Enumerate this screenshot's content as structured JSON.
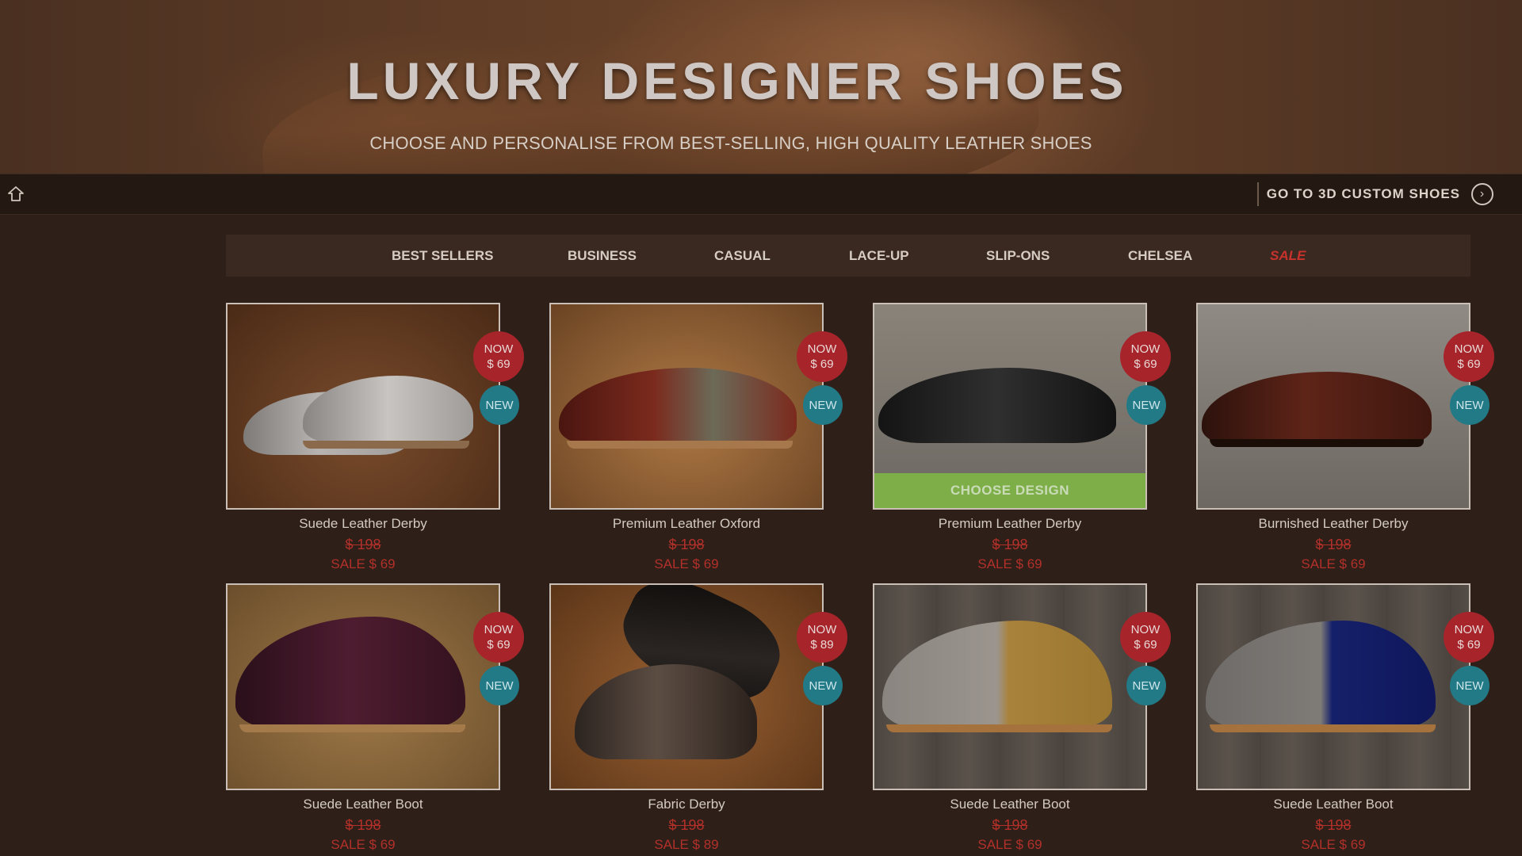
{
  "hero": {
    "title": "LUXURY DESIGNER SHOES",
    "subtitle": "CHOOSE AND PERSONALISE FROM BEST-SELLING, HIGH QUALITY LEATHER SHOES"
  },
  "topbar": {
    "home_icon": "home-outline-icon",
    "link_label": "GO TO 3D CUSTOM SHOES",
    "link_icon": "chevron-right-circle-icon"
  },
  "categories": [
    "BEST SELLERS",
    "BUSINESS",
    "CASUAL",
    "LACE-UP",
    "SLIP-ONS",
    "CHELSEA",
    "SALE"
  ],
  "colors": {
    "page_bg": "#2e2019",
    "now_badge": "#a7242b",
    "new_badge": "#227a87",
    "sale_text": "#b3302a",
    "choose_button": "#7dae48"
  },
  "products": [
    {
      "name": "Suede Leather Derby",
      "old_price": "$ 198",
      "sale": "SALE $ 69",
      "now_label": "NOW",
      "now_price": "$ 69",
      "new_label": "NEW"
    },
    {
      "name": "Premium Leather Oxford",
      "old_price": "$ 198",
      "sale": "SALE $ 69",
      "now_label": "NOW",
      "now_price": "$ 69",
      "new_label": "NEW"
    },
    {
      "name": "Premium Leather Derby",
      "old_price": "$ 198",
      "sale": "SALE $ 69",
      "now_label": "NOW",
      "now_price": "$ 69",
      "new_label": "NEW",
      "button": "CHOOSE DESIGN"
    },
    {
      "name": "Burnished Leather Derby",
      "old_price": "$ 198",
      "sale": "SALE $ 69",
      "now_label": "NOW",
      "now_price": "$ 69",
      "new_label": "NEW"
    },
    {
      "name": "Suede Leather Boot",
      "old_price": "$ 198",
      "sale": "SALE $ 69",
      "now_label": "NOW",
      "now_price": "$ 69",
      "new_label": "NEW"
    },
    {
      "name": "Fabric Derby",
      "old_price": "$ 198",
      "sale": "SALE $ 89",
      "now_label": "NOW",
      "now_price": "$ 89",
      "new_label": "NEW"
    },
    {
      "name": "Suede Leather Boot",
      "old_price": "$ 198",
      "sale": "SALE $ 69",
      "now_label": "NOW",
      "now_price": "$ 69",
      "new_label": "NEW"
    },
    {
      "name": "Suede Leather Boot",
      "old_price": "$ 198",
      "sale": "SALE $ 69",
      "now_label": "NOW",
      "now_price": "$ 69",
      "new_label": "NEW"
    }
  ]
}
